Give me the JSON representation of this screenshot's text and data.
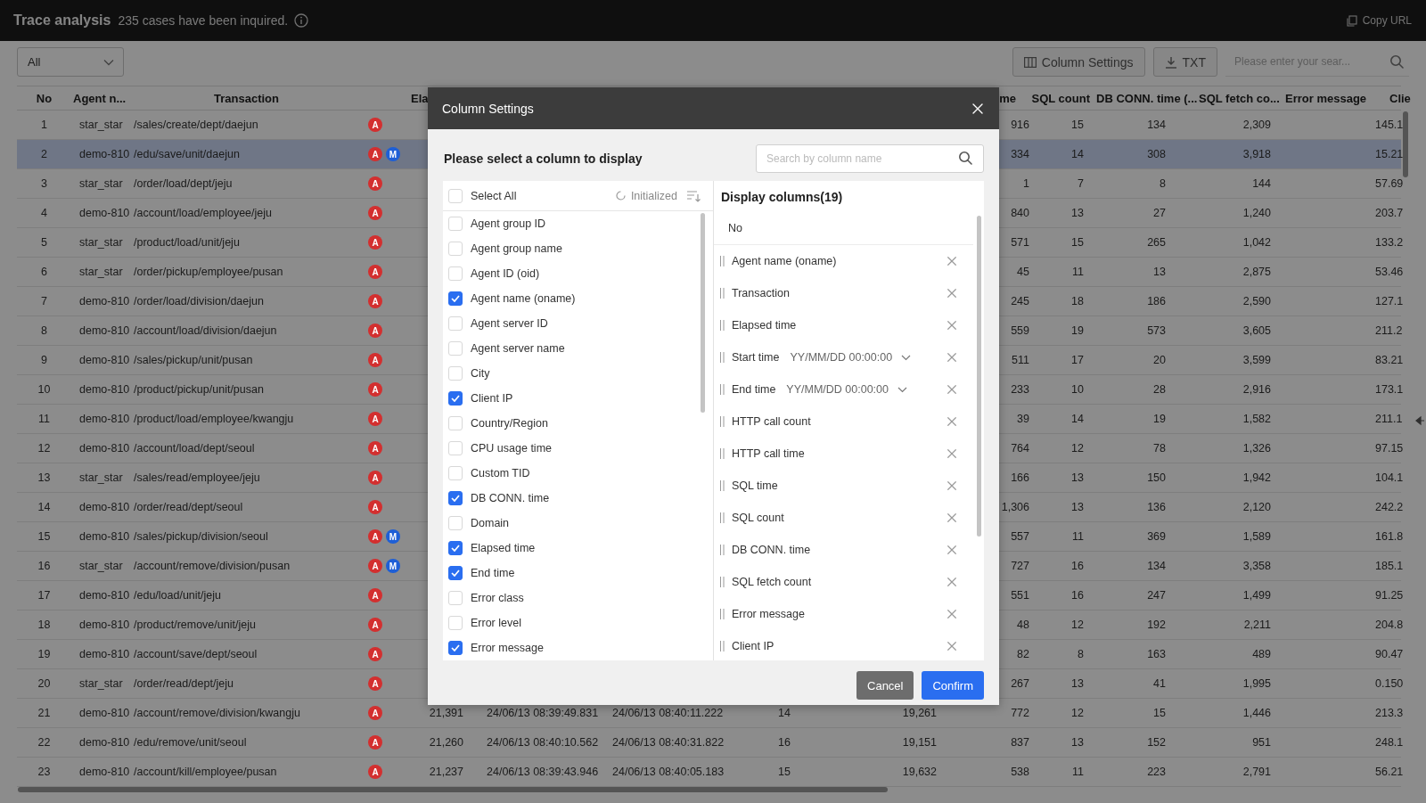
{
  "header": {
    "title": "Trace analysis",
    "summary": "235 cases have been inquired.",
    "copy_url": "Copy URL"
  },
  "toolbar": {
    "filter": "All",
    "column_settings": "Column Settings",
    "export": "TXT",
    "search": {
      "placeholder": "Please enter your sear..."
    }
  },
  "table": {
    "columns": {
      "no": "No",
      "column_2": "Agent n...",
      "transaction": "Transaction",
      "column_5": "Ela",
      "column_10": "me",
      "sql_count": "SQL count",
      "column_12": "DB CONN. time (...",
      "column_13": "SQL fetch co...",
      "error_message": "Error message",
      "column_15": "Clie"
    },
    "rows": [
      {
        "selected": false,
        "badges": [
          {
            "label": "A",
            "color": "#d32f2f"
          }
        ],
        "cells": {
          "no": "1",
          "column_2": "star_star",
          "transaction": "/sales/create/dept/daejun",
          "column_10": "916",
          "sql_count": "15",
          "column_12": "134",
          "column_13": "2,309",
          "column_15": "145.1"
        }
      },
      {
        "selected": true,
        "badges": [
          {
            "label": "A",
            "color": "#d32f2f"
          },
          {
            "label": "M",
            "color": "#1e5fd6"
          }
        ],
        "cells": {
          "no": "2",
          "column_2": "demo-810",
          "transaction": "/edu/save/unit/daejun",
          "column_10": "334",
          "sql_count": "14",
          "column_12": "308",
          "column_13": "3,918",
          "column_15": "15.21"
        }
      },
      {
        "selected": false,
        "badges": [
          {
            "label": "A",
            "color": "#d32f2f"
          }
        ],
        "cells": {
          "no": "3",
          "column_2": "star_star",
          "transaction": "/order/load/dept/jeju",
          "column_10": "1",
          "sql_count": "7",
          "column_12": "8",
          "column_13": "144",
          "column_15": "57.69"
        }
      },
      {
        "selected": false,
        "badges": [
          {
            "label": "A",
            "color": "#d32f2f"
          }
        ],
        "cells": {
          "no": "4",
          "column_2": "demo-810",
          "transaction": "/account/load/employee/jeju",
          "column_10": "840",
          "sql_count": "13",
          "column_12": "27",
          "column_13": "1,240",
          "column_15": "203.7"
        }
      },
      {
        "selected": false,
        "badges": [
          {
            "label": "A",
            "color": "#d32f2f"
          }
        ],
        "cells": {
          "no": "5",
          "column_2": "star_star",
          "transaction": "/product/load/unit/jeju",
          "column_10": "571",
          "sql_count": "15",
          "column_12": "265",
          "column_13": "1,042",
          "column_15": "133.2"
        }
      },
      {
        "selected": false,
        "badges": [
          {
            "label": "A",
            "color": "#d32f2f"
          }
        ],
        "cells": {
          "no": "6",
          "column_2": "star_star",
          "transaction": "/order/pickup/employee/pusan",
          "column_10": "45",
          "sql_count": "11",
          "column_12": "13",
          "column_13": "2,875",
          "column_15": "53.46"
        }
      },
      {
        "selected": false,
        "badges": [
          {
            "label": "A",
            "color": "#d32f2f"
          }
        ],
        "cells": {
          "no": "7",
          "column_2": "demo-810",
          "transaction": "/order/load/division/daejun",
          "column_10": "245",
          "sql_count": "18",
          "column_12": "186",
          "column_13": "2,590",
          "column_15": "127.1"
        }
      },
      {
        "selected": false,
        "badges": [
          {
            "label": "A",
            "color": "#d32f2f"
          }
        ],
        "cells": {
          "no": "8",
          "column_2": "demo-810",
          "transaction": "/account/load/division/daejun",
          "column_10": "559",
          "sql_count": "19",
          "column_12": "573",
          "column_13": "3,605",
          "column_15": "211.2"
        }
      },
      {
        "selected": false,
        "badges": [
          {
            "label": "A",
            "color": "#d32f2f"
          }
        ],
        "cells": {
          "no": "9",
          "column_2": "demo-810",
          "transaction": "/sales/pickup/unit/pusan",
          "column_10": "511",
          "sql_count": "17",
          "column_12": "20",
          "column_13": "3,599",
          "column_15": "83.21"
        }
      },
      {
        "selected": false,
        "badges": [
          {
            "label": "A",
            "color": "#d32f2f"
          }
        ],
        "cells": {
          "no": "10",
          "column_2": "demo-810",
          "transaction": "/product/pickup/unit/pusan",
          "column_10": "233",
          "sql_count": "10",
          "column_12": "28",
          "column_13": "2,916",
          "column_15": "173.1"
        }
      },
      {
        "selected": false,
        "badges": [
          {
            "label": "A",
            "color": "#d32f2f"
          }
        ],
        "cells": {
          "no": "11",
          "column_2": "demo-810",
          "transaction": "/product/load/employee/kwangju",
          "column_10": "39",
          "sql_count": "14",
          "column_12": "19",
          "column_13": "1,582",
          "column_15": "211.1"
        }
      },
      {
        "selected": false,
        "badges": [
          {
            "label": "A",
            "color": "#d32f2f"
          }
        ],
        "cells": {
          "no": "12",
          "column_2": "demo-810",
          "transaction": "/account/load/dept/seoul",
          "column_10": "764",
          "sql_count": "12",
          "column_12": "78",
          "column_13": "1,326",
          "column_15": "97.15"
        }
      },
      {
        "selected": false,
        "badges": [
          {
            "label": "A",
            "color": "#d32f2f"
          }
        ],
        "cells": {
          "no": "13",
          "column_2": "star_star",
          "transaction": "/sales/read/employee/jeju",
          "column_10": "166",
          "sql_count": "13",
          "column_12": "150",
          "column_13": "1,942",
          "column_15": "104.1"
        }
      },
      {
        "selected": false,
        "badges": [
          {
            "label": "A",
            "color": "#d32f2f"
          }
        ],
        "cells": {
          "no": "14",
          "column_2": "demo-810",
          "transaction": "/order/read/dept/seoul",
          "column_10": "1,306",
          "sql_count": "13",
          "column_12": "136",
          "column_13": "2,120",
          "column_15": "242.2"
        }
      },
      {
        "selected": false,
        "badges": [
          {
            "label": "A",
            "color": "#d32f2f"
          },
          {
            "label": "M",
            "color": "#1e5fd6"
          }
        ],
        "cells": {
          "no": "15",
          "column_2": "demo-810",
          "transaction": "/sales/pickup/division/seoul",
          "column_10": "557",
          "sql_count": "11",
          "column_12": "369",
          "column_13": "1,589",
          "column_15": "161.8"
        }
      },
      {
        "selected": false,
        "badges": [
          {
            "label": "A",
            "color": "#d32f2f"
          },
          {
            "label": "M",
            "color": "#1e5fd6"
          }
        ],
        "cells": {
          "no": "16",
          "column_2": "star_star",
          "transaction": "/account/remove/division/pusan",
          "column_10": "727",
          "sql_count": "16",
          "column_12": "134",
          "column_13": "3,358",
          "column_15": "185.1"
        }
      },
      {
        "selected": false,
        "badges": [
          {
            "label": "A",
            "color": "#d32f2f"
          }
        ],
        "cells": {
          "no": "17",
          "column_2": "demo-810",
          "transaction": "/edu/load/unit/jeju",
          "column_10": "551",
          "sql_count": "16",
          "column_12": "247",
          "column_13": "1,499",
          "column_15": "91.25"
        }
      },
      {
        "selected": false,
        "badges": [
          {
            "label": "A",
            "color": "#d32f2f"
          }
        ],
        "cells": {
          "no": "18",
          "column_2": "demo-810",
          "transaction": "/product/remove/unit/jeju",
          "column_10": "48",
          "sql_count": "12",
          "column_12": "192",
          "column_13": "2,211",
          "column_15": "204.8"
        }
      },
      {
        "selected": false,
        "badges": [
          {
            "label": "A",
            "color": "#d32f2f"
          }
        ],
        "cells": {
          "no": "19",
          "column_2": "demo-810",
          "transaction": "/account/save/dept/seoul",
          "column_10": "82",
          "sql_count": "8",
          "column_12": "163",
          "column_13": "489",
          "column_15": "90.47"
        }
      },
      {
        "selected": false,
        "badges": [
          {
            "label": "A",
            "color": "#d32f2f"
          }
        ],
        "cells": {
          "no": "20",
          "column_2": "star_star",
          "transaction": "/order/read/dept/jeju",
          "column_10": "267",
          "sql_count": "13",
          "column_12": "41",
          "column_13": "1,995",
          "column_15": "0.150"
        }
      },
      {
        "selected": false,
        "badges": [
          {
            "label": "A",
            "color": "#d32f2f"
          }
        ],
        "cells": {
          "no": "21",
          "column_2": "demo-810",
          "transaction": "/account/remove/division/kwangju",
          "column_5": "21,391",
          "column_6": "24/06/13 08:39:49.831",
          "column_7": "24/06/13 08:40:11.222",
          "column_8": "14",
          "column_9": "19,261",
          "column_10": "772",
          "sql_count": "12",
          "column_12": "15",
          "column_13": "1,446",
          "column_15": "213.3"
        }
      },
      {
        "selected": false,
        "badges": [
          {
            "label": "A",
            "color": "#d32f2f"
          }
        ],
        "cells": {
          "no": "22",
          "column_2": "demo-810",
          "transaction": "/edu/remove/unit/seoul",
          "column_5": "21,260",
          "column_6": "24/06/13 08:40:10.562",
          "column_7": "24/06/13 08:40:31.822",
          "column_8": "16",
          "column_9": "19,151",
          "column_10": "837",
          "sql_count": "13",
          "column_12": "152",
          "column_13": "951",
          "column_15": "248.1"
        }
      },
      {
        "selected": false,
        "badges": [
          {
            "label": "A",
            "color": "#d32f2f"
          }
        ],
        "cells": {
          "no": "23",
          "column_2": "demo-810",
          "transaction": "/account/kill/employee/pusan",
          "column_5": "21,237",
          "column_6": "24/06/13 08:39:43.946",
          "column_7": "24/06/13 08:40:05.183",
          "column_8": "15",
          "column_9": "19,632",
          "column_10": "538",
          "sql_count": "11",
          "column_12": "223",
          "column_13": "2,791",
          "column_15": "56.21"
        }
      }
    ]
  },
  "column_settings": {
    "title": "Column Settings",
    "prompt": "Please select a column to display",
    "search": {
      "placeholder": "Search by column name"
    },
    "select_all": {
      "label": "Select All",
      "checked": false
    },
    "reset": "Initialized",
    "options": [
      {
        "label": "Agent group ID",
        "checked": false
      },
      {
        "label": "Agent group name",
        "checked": false
      },
      {
        "label": "Agent ID (oid)",
        "checked": false
      },
      {
        "label": "Agent name (oname)",
        "checked": true
      },
      {
        "label": "Agent server ID",
        "checked": false
      },
      {
        "label": "Agent server name",
        "checked": false
      },
      {
        "label": "City",
        "checked": false
      },
      {
        "label": "Client IP",
        "checked": true
      },
      {
        "label": "Country/Region",
        "checked": false
      },
      {
        "label": "CPU usage time",
        "checked": false
      },
      {
        "label": "Custom TID",
        "checked": false
      },
      {
        "label": "DB CONN. time",
        "checked": true
      },
      {
        "label": "Domain",
        "checked": false
      },
      {
        "label": "Elapsed time",
        "checked": true
      },
      {
        "label": "End time",
        "checked": true
      },
      {
        "label": "Error class",
        "checked": false
      },
      {
        "label": "Error level",
        "checked": false
      },
      {
        "label": "Error message",
        "checked": true
      }
    ],
    "display_title": "Display columns(19)",
    "display_columns": [
      {
        "kind": "fixed",
        "label": "No"
      },
      {
        "kind": "removable",
        "label": "Agent name (oname)"
      },
      {
        "kind": "removable",
        "label": "Transaction"
      },
      {
        "kind": "removable",
        "label": "Elapsed time"
      },
      {
        "kind": "format",
        "label": "Start time",
        "format": "YY/MM/DD 00:00:00"
      },
      {
        "kind": "format",
        "label": "End time",
        "format": "YY/MM/DD 00:00:00"
      },
      {
        "kind": "removable",
        "label": "HTTP call count"
      },
      {
        "kind": "removable",
        "label": "HTTP call time"
      },
      {
        "kind": "removable",
        "label": "SQL time"
      },
      {
        "kind": "removable",
        "label": "SQL count"
      },
      {
        "kind": "removable",
        "label": "DB CONN. time"
      },
      {
        "kind": "removable",
        "label": "SQL fetch count"
      },
      {
        "kind": "removable",
        "label": "Error message"
      },
      {
        "kind": "removable",
        "label": "Client IP"
      }
    ],
    "buttons": {
      "cancel": "Cancel",
      "confirm": "Confirm"
    }
  }
}
